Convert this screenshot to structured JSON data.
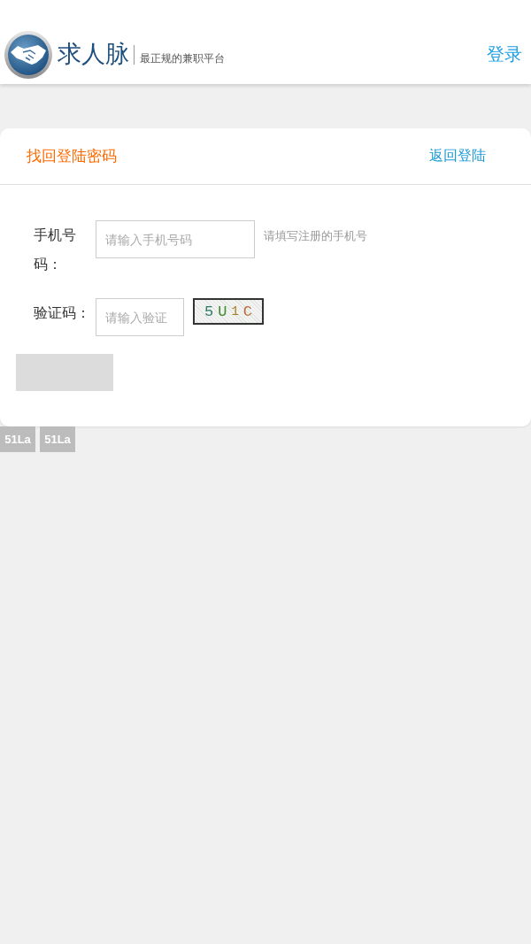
{
  "header": {
    "logo": {
      "name": "求人脉",
      "tagline": "最正规的兼职平台"
    },
    "login_link": "登录"
  },
  "card": {
    "title": "找回登陆密码",
    "back_link": "返回登陆"
  },
  "form": {
    "fields": [
      {
        "kind": "phone",
        "label": "手机号码：",
        "placeholder": "请输入手机号码",
        "hint": "请填写注册的手机号"
      },
      {
        "kind": "captcha",
        "label": "验证码：",
        "placeholder": "请输入验证",
        "captcha": "5U1C"
      }
    ]
  },
  "badges": [
    "51La",
    "51La"
  ]
}
